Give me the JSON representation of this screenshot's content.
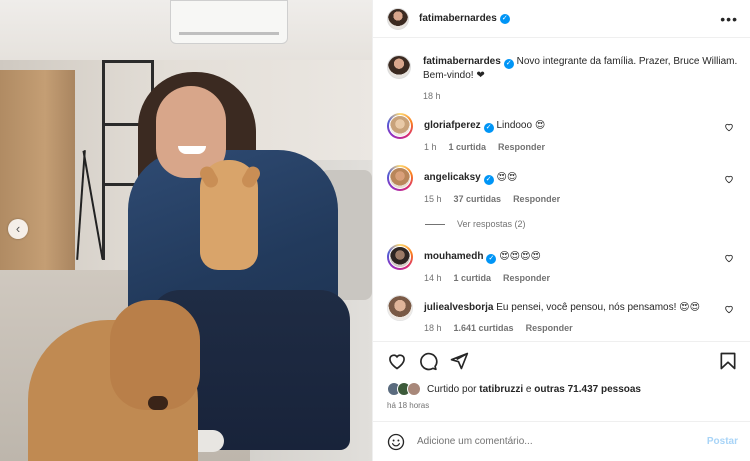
{
  "post": {
    "author": "fatimabernardes",
    "caption": "Novo integrante da família. Prazer, Bruce William. Bem-vindo! ❤",
    "caption_time": "18 h",
    "prev_icon": "chevron-left-icon"
  },
  "comments": [
    {
      "user": "gloriafperez",
      "verified": true,
      "text": "Lindooo 😍",
      "time": "1 h",
      "likes": "1 curtida",
      "reply": "Responder"
    },
    {
      "user": "angelicaksy",
      "verified": true,
      "text": "😍😍",
      "time": "15 h",
      "likes": "37 curtidas",
      "reply": "Responder"
    },
    {
      "user": "mouhamedh",
      "verified": true,
      "text": "😍😍😍😍",
      "time": "14 h",
      "likes": "1 curtida",
      "reply": "Responder"
    },
    {
      "user": "juliealvesborja",
      "verified": false,
      "text": "Eu pensei, você pensou, nós pensamos! 😍😍",
      "time": "18 h",
      "likes": "1.641 curtidas",
      "reply": "Responder"
    }
  ],
  "view_replies": "Ver respostas (2)",
  "liked_by": {
    "prefix": "Curtido por",
    "user": "tatibruzzi",
    "middle": "e",
    "others": "outras 71.437 pessoas"
  },
  "time_ago": "há 18 horas",
  "add_comment": {
    "placeholder": "Adicione um comentário...",
    "post_label": "Postar"
  },
  "colors": {
    "verified": "#0095f6",
    "post_button": "#a8d4f7",
    "meta": "#737373"
  }
}
